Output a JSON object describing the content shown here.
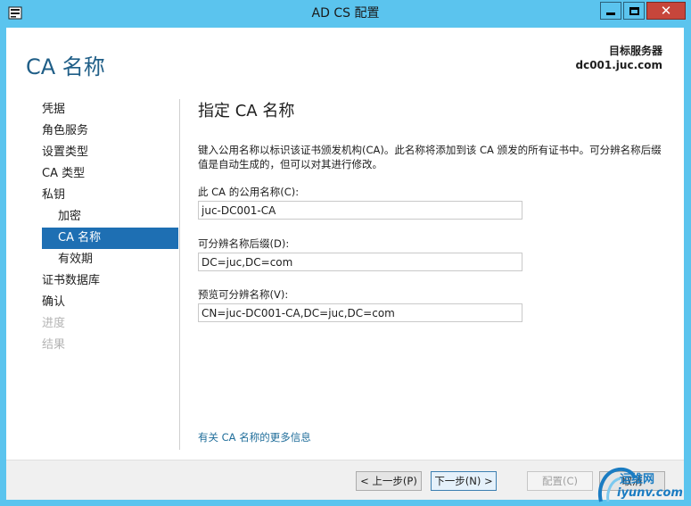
{
  "window": {
    "title": "AD CS 配置",
    "app_icon": "server-role-icon",
    "minimize_icon": "minimize-icon",
    "maximize_icon": "maximize-icon",
    "close_icon": "close-icon"
  },
  "header": {
    "page_title": "CA 名称",
    "target_label": "目标服务器",
    "target_value": "dc001.juc.com"
  },
  "sidebar": {
    "items": [
      {
        "label": "凭据",
        "state": "normal",
        "level": 0
      },
      {
        "label": "角色服务",
        "state": "normal",
        "level": 0
      },
      {
        "label": "设置类型",
        "state": "normal",
        "level": 0
      },
      {
        "label": "CA 类型",
        "state": "normal",
        "level": 0
      },
      {
        "label": "私钥",
        "state": "normal",
        "level": 0
      },
      {
        "label": "加密",
        "state": "normal",
        "level": 1
      },
      {
        "label": "CA 名称",
        "state": "active",
        "level": 1
      },
      {
        "label": "有效期",
        "state": "normal",
        "level": 1
      },
      {
        "label": "证书数据库",
        "state": "normal",
        "level": 0
      },
      {
        "label": "确认",
        "state": "normal",
        "level": 0
      },
      {
        "label": "进度",
        "state": "disabled",
        "level": 0
      },
      {
        "label": "结果",
        "state": "disabled",
        "level": 0
      }
    ]
  },
  "main": {
    "section_title": "指定 CA 名称",
    "description": "键入公用名称以标识该证书颁发机构(CA)。此名称将添加到该 CA 颁发的所有证书中。可分辨名称后缀值是自动生成的，但可以对其进行修改。",
    "common_name_label": "此 CA 的公用名称(C):",
    "common_name_value": "juc-DC001-CA",
    "dn_suffix_label": "可分辨名称后缀(D):",
    "dn_suffix_value": "DC=juc,DC=com",
    "preview_label": "预览可分辨名称(V):",
    "preview_value": "CN=juc-DC001-CA,DC=juc,DC=com",
    "more_info_link": "有关 CA 名称的更多信息"
  },
  "footer": {
    "prev_label": "< 上一步(P)",
    "next_label": "下一步(N) >",
    "config_label": "配置(C)",
    "cancel_label": "取消"
  },
  "watermark": {
    "line1": "运维网",
    "line2": "iyunv.com"
  },
  "colors": {
    "titlebar": "#5bc4ee",
    "accent": "#1e6fb3",
    "title_blue": "#1f5e87",
    "close_red": "#c7463b"
  }
}
